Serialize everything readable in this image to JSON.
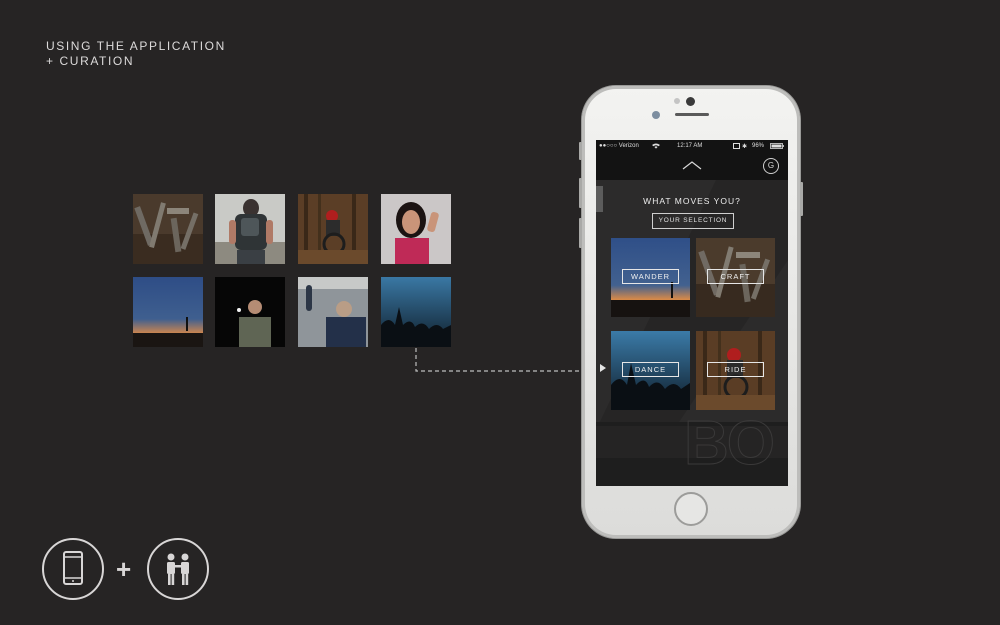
{
  "heading": {
    "line1": "USING THE APPLICATION",
    "line2": "+ CURATION"
  },
  "thumbnails": [
    {
      "subject": "tools"
    },
    {
      "subject": "backpack-runner"
    },
    {
      "subject": "mountain-bike"
    },
    {
      "subject": "woman-speaker"
    },
    {
      "subject": "dusk-silhouette"
    },
    {
      "subject": "stage-speaker"
    },
    {
      "subject": "crowd-raised-arm"
    },
    {
      "subject": "concert-crowd"
    }
  ],
  "phone": {
    "status": {
      "carrier": "●●○○○ Verizon",
      "time": "12:17 AM",
      "battery": "96%"
    },
    "nav": {
      "up_icon": "chevron-up-icon",
      "profile_letter": "G"
    },
    "screen": {
      "title": "WHAT MOVES YOU?",
      "selection_button": "YOUR SELECTION",
      "tiles": [
        {
          "label": "WANDER"
        },
        {
          "label": "CRAFT"
        },
        {
          "label": "DANCE"
        },
        {
          "label": "RIDE"
        }
      ]
    }
  },
  "bottom_icons": {
    "left": "smartphone-icon",
    "middle": "+",
    "right": "people-icon"
  }
}
